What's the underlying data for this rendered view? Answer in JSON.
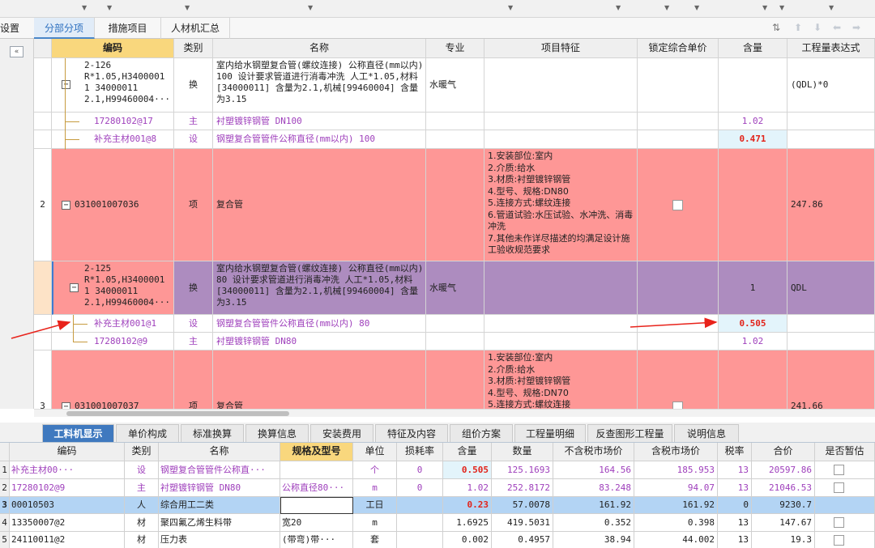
{
  "tabs": [
    "设置",
    "分部分项",
    "措施项目",
    "人材机汇总"
  ],
  "columns": [
    "编码",
    "类别",
    "名称",
    "专业",
    "项目特征",
    "锁定综合单价",
    "含量",
    "工程量表达式"
  ],
  "rows": [
    {
      "code": [
        "2-126",
        "R*1.05,H3400001",
        "1 34000011",
        "2.1,H99460004···"
      ],
      "type": "换",
      "name": "室内给水钢塑复合管(螺纹连接) 公称直径(mm以内) 100  设计要求管道进行消毒冲洗 人工*1.05,材料[34000011] 含量为2.1,机械[99460004] 含量为3.15",
      "major": "水暖气",
      "qty": "",
      "expr": "(QDL)*0"
    },
    {
      "code": "17280102@17",
      "type": "主",
      "name": "衬塑镀锌钢管 DN100",
      "qty": "1.02"
    },
    {
      "code": "补充主材001@8",
      "type": "设",
      "name": "钢塑复合管管件公称直径(mm以内) 100",
      "qty": "0.471"
    },
    {
      "num": "2",
      "code": "031001007036",
      "type": "项",
      "name": "复合管",
      "features": [
        "1.安装部位:室内",
        "2.介质:给水",
        "3.材质:衬塑镀锌钢管",
        "4.型号、规格:DN80",
        "5.连接方式:螺纹连接",
        "6.管道试验:水压试验、水冲洗、消毒冲洗",
        "7.其他未作详尽描述的均满足设计施工验收规范要求"
      ],
      "expr": "247.86"
    },
    {
      "code": [
        "2-125",
        "R*1.05,H3400001",
        "1 34000011",
        "2.1,H99460004···"
      ],
      "type": "换",
      "name": "室内给水钢塑复合管(螺纹连接) 公称直径(mm以内) 80  设计要求管道进行消毒冲洗 人工*1.05,材料[34000011] 含量为2.1,机械[99460004] 含量为3.15",
      "major": "水暖气",
      "qty": "1",
      "expr": "QDL"
    },
    {
      "code": "补充主材001@1",
      "type": "设",
      "name": "钢塑复合管管件公称直径(mm以内) 80",
      "qty": "0.505"
    },
    {
      "code": "17280102@9",
      "type": "主",
      "name": "衬塑镀锌钢管 DN80",
      "qty": "1.02"
    },
    {
      "num": "3",
      "code": "031001007037",
      "type": "项",
      "name": "复合管",
      "features": [
        "1.安装部位:室内",
        "2.介质:给水",
        "3.材质:衬塑镀锌钢管",
        "4.型号、规格:DN70",
        "5.连接方式:螺纹连接"
      ],
      "expr": "241.66"
    }
  ],
  "bottom_tabs": [
    "工料机显示",
    "单价构成",
    "标准换算",
    "换算信息",
    "安装费用",
    "特征及内容",
    "组价方案",
    "工程量明细",
    "反查图形工程量",
    "说明信息"
  ],
  "bottom_columns": [
    "编码",
    "类别",
    "名称",
    "规格及型号",
    "单位",
    "损耗率",
    "含量",
    "数量",
    "不含税市场价",
    "含税市场价",
    "税率",
    "合价",
    "是否暂估"
  ],
  "bottom_rows": [
    {
      "n": "1",
      "code": "补充主材00···",
      "type": "设",
      "name": "钢塑复合管管件公称直···",
      "spec": "",
      "unit": "个",
      "loss": "0",
      "content": "0.505",
      "qty": "125.1693",
      "price_ex": "164.56",
      "price_in": "185.953",
      "tax": "13",
      "total": "20597.86"
    },
    {
      "n": "2",
      "code": "17280102@9",
      "type": "主",
      "name": "衬塑镀锌钢管 DN80",
      "spec": "公称直径80···",
      "unit": "m",
      "loss": "0",
      "content": "1.02",
      "qty": "252.8172",
      "price_ex": "83.248",
      "price_in": "94.07",
      "tax": "13",
      "total": "21046.53"
    },
    {
      "n": "3",
      "code": "00010503",
      "type": "人",
      "name": "综合用工二类",
      "spec": "",
      "unit": "工日",
      "loss": "",
      "content": "0.23",
      "qty": "57.0078",
      "price_ex": "161.92",
      "price_in": "161.92",
      "tax": "0",
      "total": "9230.7"
    },
    {
      "n": "4",
      "code": "13350007@2",
      "type": "材",
      "name": "聚四氟乙烯生料带",
      "spec": "宽20",
      "unit": "m",
      "loss": "",
      "content": "1.6925",
      "qty": "419.5031",
      "price_ex": "0.352",
      "price_in": "0.398",
      "tax": "13",
      "total": "147.67"
    },
    {
      "n": "5",
      "code": "24110011@2",
      "type": "材",
      "name": "压力表",
      "spec": "(带弯)带···",
      "unit": "套",
      "loss": "",
      "content": "0.002",
      "qty": "0.4957",
      "price_ex": "38.94",
      "price_in": "44.002",
      "tax": "13",
      "total": "19.3"
    }
  ]
}
